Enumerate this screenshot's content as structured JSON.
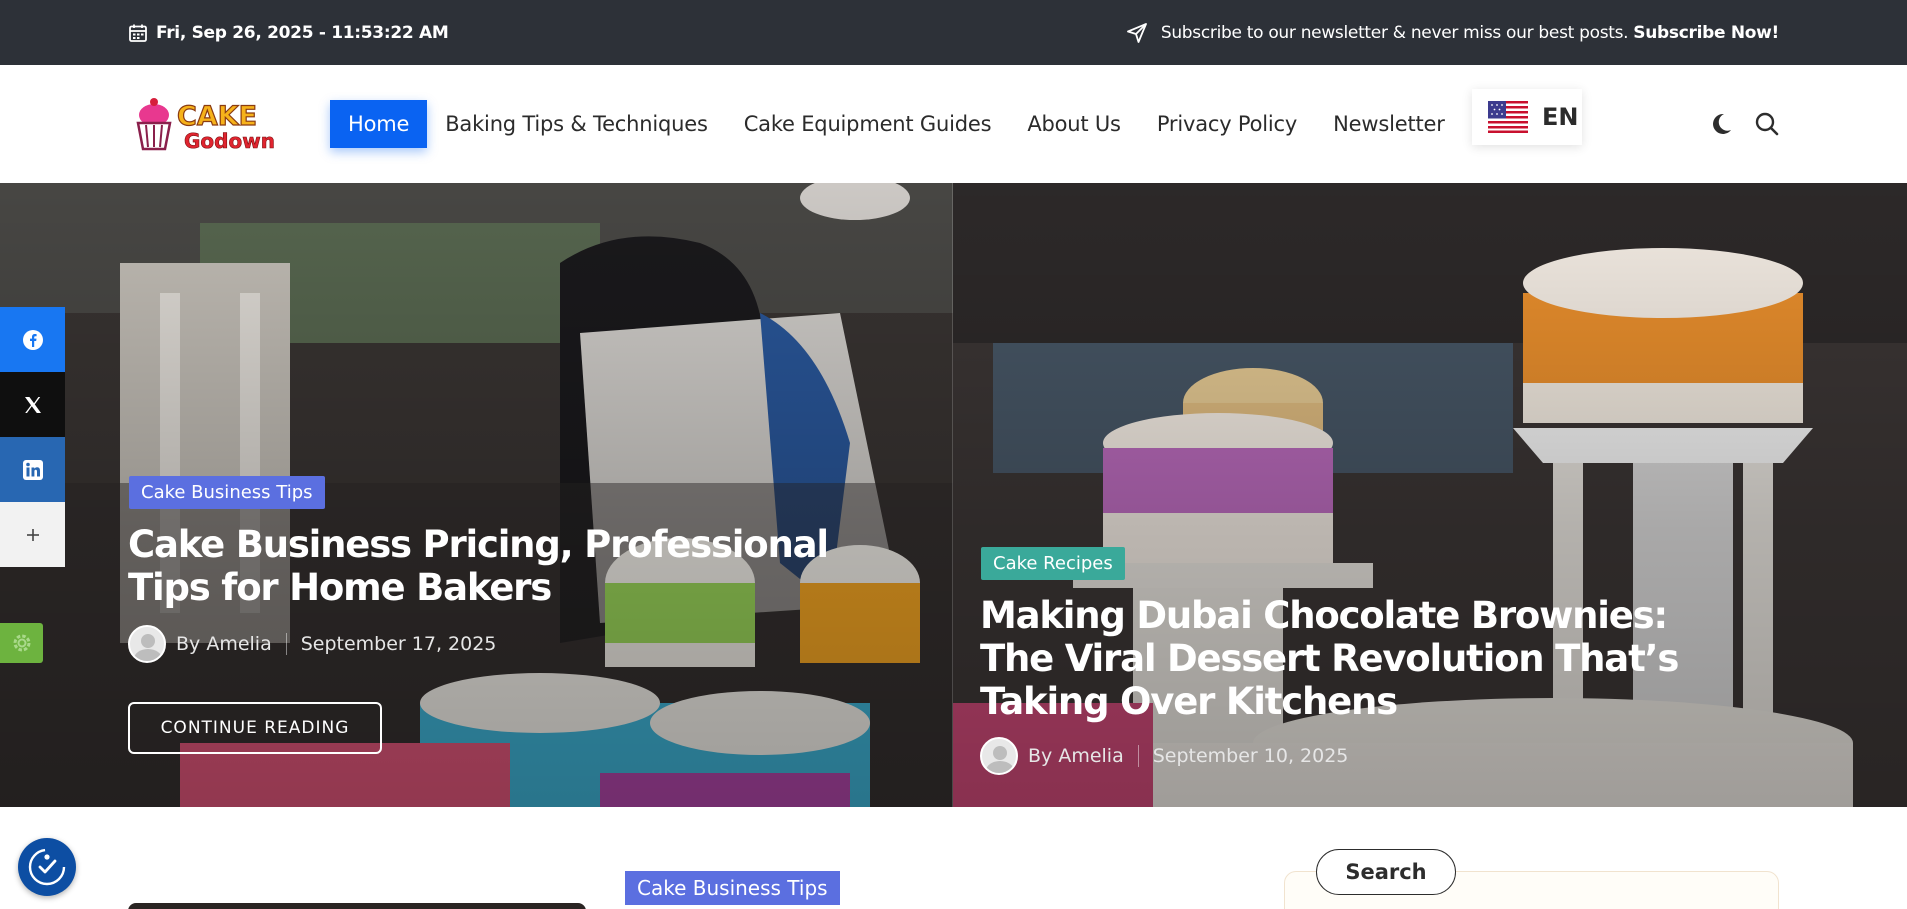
{
  "topbar": {
    "datetime": "Fri, Sep 26, 2025 - 11:53:22 AM",
    "subscribe_text": "Subscribe to our newsletter & never miss our best posts.",
    "subscribe_link": "Subscribe Now!"
  },
  "header": {
    "logo_line1": "CAKE",
    "logo_line2": "Godown",
    "nav": [
      {
        "label": "Home",
        "active": true
      },
      {
        "label": "Baking Tips & Techniques"
      },
      {
        "label": "Cake Equipment Guides"
      },
      {
        "label": "About Us"
      },
      {
        "label": "Privacy Policy"
      },
      {
        "label": "Newsletter"
      }
    ],
    "language": "EN"
  },
  "hero": {
    "slides": [
      {
        "category": "Cake Business Tips",
        "category_color": "#5b6fe0",
        "title": "Cake Business Pricing, Professional Tips for Home Bakers",
        "author": "By Amelia",
        "date": "September 17, 2025",
        "button": "CONTINUE READING"
      },
      {
        "category": "Cake Recipes",
        "category_color": "#3aa99a",
        "title": "Making Dubai Chocolate Brownies: The Viral Dessert Revolution That’s Taking Over Kitchens",
        "author": "By Amelia",
        "date": "September 10, 2025"
      }
    ]
  },
  "social": [
    {
      "name": "facebook",
      "color": "#1877f2"
    },
    {
      "name": "x",
      "color": "#0f0f0f"
    },
    {
      "name": "linkedin",
      "color": "#2867b2"
    },
    {
      "name": "more",
      "color": "#f2f2f2"
    }
  ],
  "below": {
    "category": "Cake Business Tips",
    "widget_title": "Search"
  }
}
